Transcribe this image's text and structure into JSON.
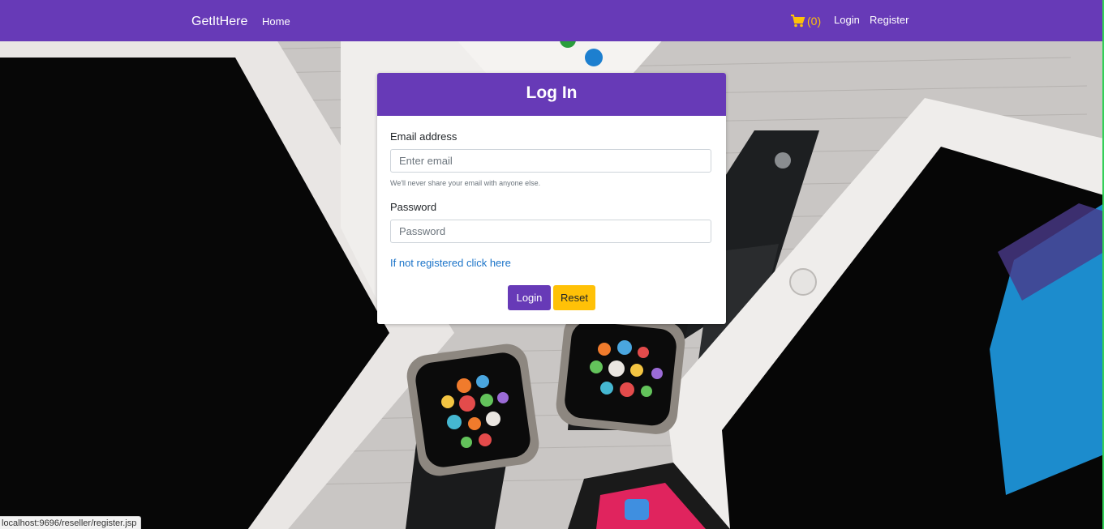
{
  "navbar": {
    "brand": "GetItHere",
    "home": "Home",
    "cart_icon": "cart-icon",
    "cart_count": "(0)",
    "login": "Login",
    "register": "Register"
  },
  "card": {
    "title": "Log In",
    "email_label": "Email address",
    "email_placeholder": "Enter email",
    "email_value": "",
    "email_help": "We'll never share your email with anyone else.",
    "password_label": "Password",
    "password_placeholder": "Password",
    "password_value": "",
    "register_link": "If not registered click here",
    "login_button": "Login",
    "reset_button": "Reset"
  },
  "status_bar": {
    "url": "localhost:9696/reseller/register.jsp"
  },
  "colors": {
    "primary": "#673ab7",
    "warning": "#ffc107",
    "link": "#1a73c8"
  }
}
